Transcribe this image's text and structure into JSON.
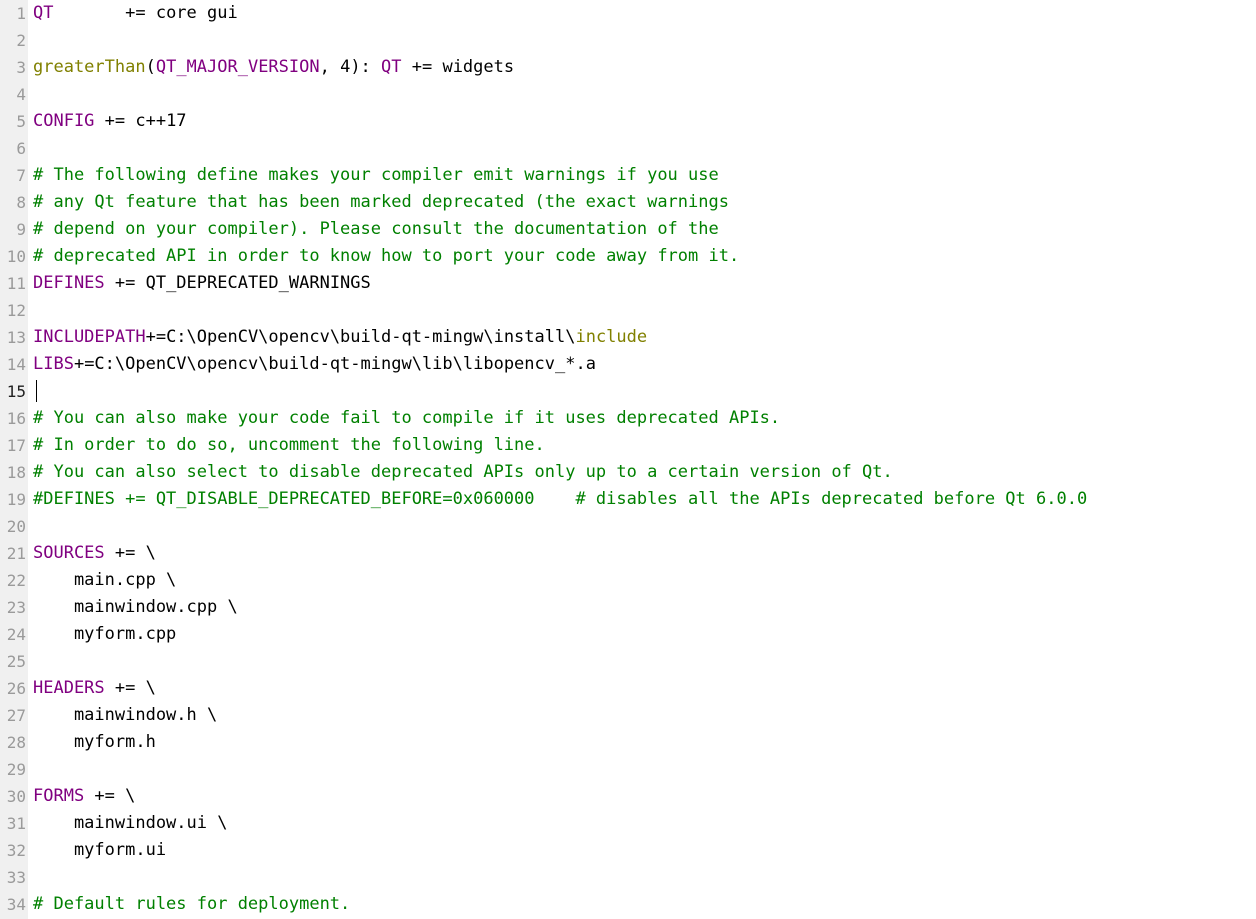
{
  "editor": {
    "current_line": 15,
    "colors": {
      "background": "#ffffff",
      "gutter": "#f0f0f0",
      "line_number": "#9a9a9a",
      "comment": "#008000",
      "variable": "#800080",
      "function": "#808000",
      "text": "#000000"
    },
    "lines": [
      {
        "n": "1",
        "segs": [
          {
            "t": "v",
            "s": "QT"
          },
          {
            "t": "p",
            "s": "       += core gui"
          }
        ]
      },
      {
        "n": "2",
        "segs": []
      },
      {
        "n": "3",
        "segs": [
          {
            "t": "f",
            "s": "greaterThan"
          },
          {
            "t": "p",
            "s": "("
          },
          {
            "t": "v",
            "s": "QT_MAJOR_VERSION"
          },
          {
            "t": "p",
            "s": ", 4): "
          },
          {
            "t": "v",
            "s": "QT"
          },
          {
            "t": "p",
            "s": " += widgets"
          }
        ]
      },
      {
        "n": "4",
        "segs": []
      },
      {
        "n": "5",
        "segs": [
          {
            "t": "v",
            "s": "CONFIG"
          },
          {
            "t": "p",
            "s": " += c++17"
          }
        ]
      },
      {
        "n": "6",
        "segs": []
      },
      {
        "n": "7",
        "segs": [
          {
            "t": "c",
            "s": "# The following define makes your compiler emit warnings if you use"
          }
        ]
      },
      {
        "n": "8",
        "segs": [
          {
            "t": "c",
            "s": "# any Qt feature that has been marked deprecated (the exact warnings"
          }
        ]
      },
      {
        "n": "9",
        "segs": [
          {
            "t": "c",
            "s": "# depend on your compiler). Please consult the documentation of the"
          }
        ]
      },
      {
        "n": "10",
        "segs": [
          {
            "t": "c",
            "s": "# deprecated API in order to know how to port your code away from it."
          }
        ]
      },
      {
        "n": "11",
        "segs": [
          {
            "t": "v",
            "s": "DEFINES"
          },
          {
            "t": "p",
            "s": " += QT_DEPRECATED_WARNINGS"
          }
        ]
      },
      {
        "n": "12",
        "segs": []
      },
      {
        "n": "13",
        "segs": [
          {
            "t": "v",
            "s": "INCLUDEPATH"
          },
          {
            "t": "p",
            "s": "+=C:\\OpenCV\\opencv\\build-qt-mingw\\install\\"
          },
          {
            "t": "f",
            "s": "include"
          }
        ]
      },
      {
        "n": "14",
        "segs": [
          {
            "t": "v",
            "s": "LIBS"
          },
          {
            "t": "p",
            "s": "+=C:\\OpenCV\\opencv\\build-qt-mingw\\lib\\libopencv_*.a"
          }
        ]
      },
      {
        "n": "15",
        "segs": []
      },
      {
        "n": "16",
        "segs": [
          {
            "t": "c",
            "s": "# You can also make your code fail to compile if it uses deprecated APIs."
          }
        ]
      },
      {
        "n": "17",
        "segs": [
          {
            "t": "c",
            "s": "# In order to do so, uncomment the following line."
          }
        ]
      },
      {
        "n": "18",
        "segs": [
          {
            "t": "c",
            "s": "# You can also select to disable deprecated APIs only up to a certain version of Qt."
          }
        ]
      },
      {
        "n": "19",
        "segs": [
          {
            "t": "c",
            "s": "#DEFINES += QT_DISABLE_DEPRECATED_BEFORE=0x060000    # disables all the APIs deprecated before Qt 6.0.0"
          }
        ]
      },
      {
        "n": "20",
        "segs": []
      },
      {
        "n": "21",
        "segs": [
          {
            "t": "v",
            "s": "SOURCES"
          },
          {
            "t": "p",
            "s": " += \\"
          }
        ]
      },
      {
        "n": "22",
        "segs": [
          {
            "t": "p",
            "s": "    main.cpp \\"
          }
        ]
      },
      {
        "n": "23",
        "segs": [
          {
            "t": "p",
            "s": "    mainwindow.cpp \\"
          }
        ]
      },
      {
        "n": "24",
        "segs": [
          {
            "t": "p",
            "s": "    myform.cpp"
          }
        ]
      },
      {
        "n": "25",
        "segs": []
      },
      {
        "n": "26",
        "segs": [
          {
            "t": "v",
            "s": "HEADERS"
          },
          {
            "t": "p",
            "s": " += \\"
          }
        ]
      },
      {
        "n": "27",
        "segs": [
          {
            "t": "p",
            "s": "    mainwindow.h \\"
          }
        ]
      },
      {
        "n": "28",
        "segs": [
          {
            "t": "p",
            "s": "    myform.h"
          }
        ]
      },
      {
        "n": "29",
        "segs": []
      },
      {
        "n": "30",
        "segs": [
          {
            "t": "v",
            "s": "FORMS"
          },
          {
            "t": "p",
            "s": " += \\"
          }
        ]
      },
      {
        "n": "31",
        "segs": [
          {
            "t": "p",
            "s": "    mainwindow.ui \\"
          }
        ]
      },
      {
        "n": "32",
        "segs": [
          {
            "t": "p",
            "s": "    myform.ui"
          }
        ]
      },
      {
        "n": "33",
        "segs": []
      },
      {
        "n": "34",
        "segs": [
          {
            "t": "c",
            "s": "# Default rules for deployment."
          }
        ]
      }
    ]
  }
}
